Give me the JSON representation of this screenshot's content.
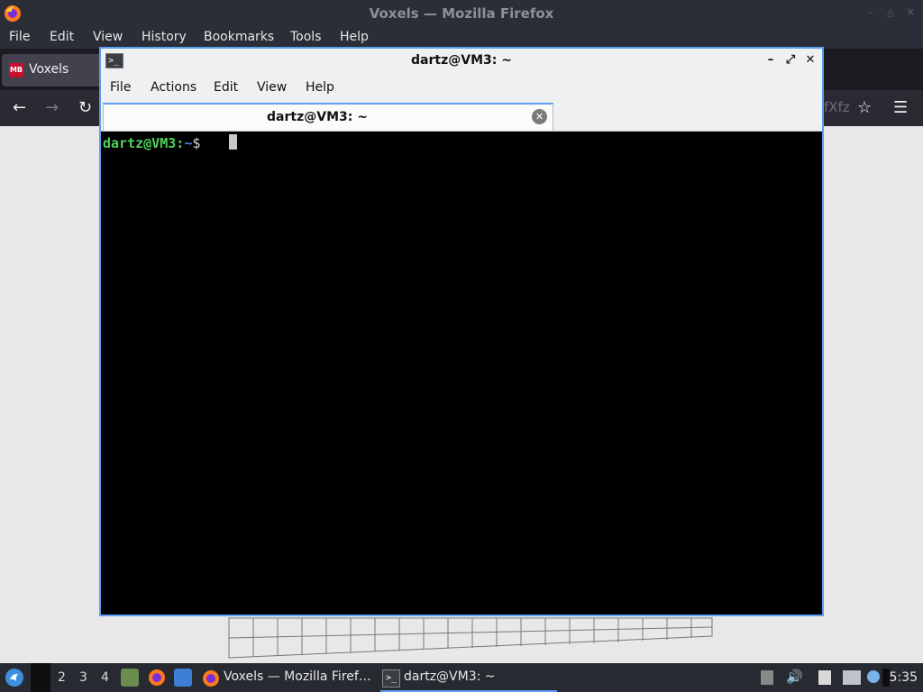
{
  "firefox": {
    "title": "Voxels — Mozilla Firefox",
    "menu": [
      {
        "label": "File"
      },
      {
        "label": "Edit"
      },
      {
        "label": "View"
      },
      {
        "label": "History"
      },
      {
        "label": "Bookmarks"
      },
      {
        "label": "Tools"
      },
      {
        "label": "Help"
      }
    ],
    "tab_label": "Voxels",
    "tab_favicon_text": "MB",
    "url_fragment": "fXfz"
  },
  "terminal": {
    "title": "dartz@VM3: ~",
    "menu": [
      {
        "label": "File"
      },
      {
        "label": "Actions"
      },
      {
        "label": "Edit"
      },
      {
        "label": "View"
      },
      {
        "label": "Help"
      }
    ],
    "tab_label": "dartz@VM3: ~",
    "prompt": {
      "user_host": "dartz@VM3",
      "colon": ":",
      "path": "~",
      "symbol": "$"
    }
  },
  "taskbar": {
    "workspaces": [
      "2",
      "3",
      "4"
    ],
    "tasks": [
      {
        "label": "Voxels — Mozilla Firef…",
        "icon": "firefox-icon"
      },
      {
        "label": "dartz@VM3: ~",
        "icon": "terminal-icon"
      }
    ],
    "clock": "5:35"
  },
  "colors": {
    "accent": "#5c9ded",
    "prompt_user": "#4dd35a",
    "prompt_path": "#5b7cf0",
    "terminal_bg": "#000000"
  }
}
